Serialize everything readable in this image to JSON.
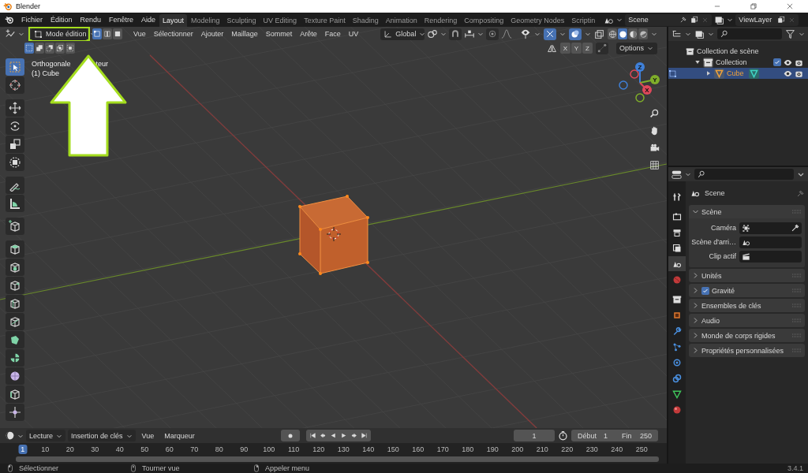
{
  "window": {
    "title": "Blender"
  },
  "menus": [
    "Fichier",
    "Édition",
    "Rendu",
    "Fenêtre",
    "Aide"
  ],
  "workspaces": [
    {
      "label": "Layout",
      "selected": true
    },
    {
      "label": "Modeling",
      "selected": false
    },
    {
      "label": "Sculpting",
      "selected": false
    },
    {
      "label": "UV Editing",
      "selected": false
    },
    {
      "label": "Texture Paint",
      "selected": false
    },
    {
      "label": "Shading",
      "selected": false
    },
    {
      "label": "Animation",
      "selected": false
    },
    {
      "label": "Rendering",
      "selected": false
    },
    {
      "label": "Compositing",
      "selected": false
    },
    {
      "label": "Geometry Nodes",
      "selected": false
    },
    {
      "label": "Scriptin",
      "selected": false
    }
  ],
  "scene": "Scene",
  "view_layer": "ViewLayer",
  "viewport": {
    "mode": "Mode édition",
    "select_modes": [
      {
        "selected": true
      },
      {
        "selected": false
      },
      {
        "selected": false
      }
    ],
    "menus": [
      "Vue",
      "Sélectionner",
      "Ajouter",
      "Maillage",
      "Sommet",
      "Arête",
      "Face",
      "UV"
    ],
    "orientation": "Global",
    "select_ops": [
      {
        "selected": true
      },
      {
        "selected": false
      },
      {
        "selected": false
      },
      {
        "selected": false
      },
      {
        "selected": false
      }
    ],
    "mirror_axes": [
      {
        "label": "X",
        "on": false
      },
      {
        "label": "Y",
        "on": false
      },
      {
        "label": "Z",
        "on": false
      }
    ],
    "options": "Options",
    "view_name": [
      "Orthogonale",
      "teur"
    ],
    "object_name": "(1) Cube",
    "gizmo_axes": [
      {
        "label": "Z",
        "color": "#3f80d8"
      },
      {
        "label": "Y",
        "color": "#7fae2a"
      },
      {
        "label": "X",
        "color": "#e0485a"
      }
    ],
    "tool_groups": [
      [
        {
          "selected": true
        },
        {
          "selected": false
        }
      ],
      [
        {
          "selected": false
        },
        {
          "selected": false
        },
        {
          "selected": false
        },
        {
          "selected": false
        }
      ],
      [
        {
          "selected": false
        },
        {
          "selected": false
        }
      ],
      [
        {
          "selected": false
        }
      ],
      [
        {
          "selected": false
        },
        {
          "selected": false
        },
        {
          "selected": false
        },
        {
          "selected": false
        },
        {
          "selected": false
        },
        {
          "selected": false
        },
        {
          "selected": false
        },
        {
          "selected": false
        },
        {
          "selected": false
        },
        {
          "selected": false
        }
      ]
    ]
  },
  "outliner": {
    "tree": [
      {
        "label": "Collection de scène",
        "kind": "scene_collection",
        "selected": false,
        "children": [
          {
            "label": "Collection",
            "kind": "collection",
            "selected": false,
            "expanded": true,
            "checked": true,
            "children": [
              {
                "label": "Cube",
                "kind": "object",
                "selected": true,
                "expanded": false
              }
            ]
          }
        ]
      }
    ]
  },
  "properties": {
    "tab_groups": [
      [
        {
          "selected": false
        }
      ],
      [
        {
          "selected": false
        },
        {
          "selected": false
        },
        {
          "selected": false
        },
        {
          "selected": true
        },
        {
          "selected": false
        }
      ],
      [
        {
          "selected": false
        },
        {
          "selected": false
        },
        {
          "selected": false
        },
        {
          "selected": false
        },
        {
          "selected": false
        },
        {
          "selected": false
        },
        {
          "selected": false
        },
        {
          "selected": false
        }
      ]
    ],
    "title": "Scene",
    "panels": [
      {
        "label": "Scène",
        "kind": "plain",
        "expanded": true,
        "fields": [
          {
            "label": "Caméra"
          },
          {
            "label": "Scène d'arri…"
          },
          {
            "label": "Clip actif"
          }
        ]
      },
      {
        "label": "Unités",
        "kind": "plain",
        "expanded": false
      },
      {
        "label": "Gravité",
        "kind": "toggle",
        "expanded": false,
        "checked": true
      },
      {
        "label": "Ensembles de clés",
        "kind": "plain",
        "expanded": false
      },
      {
        "label": "Audio",
        "kind": "plain",
        "expanded": false
      },
      {
        "label": "Monde de corps rigides",
        "kind": "plain",
        "expanded": false
      },
      {
        "label": "Propriétés personnalisées",
        "kind": "plain",
        "expanded": false
      }
    ]
  },
  "timeline": {
    "menus": [
      {
        "label": "Lecture",
        "kind": "dropdown"
      },
      {
        "label": "Insertion de clés",
        "kind": "dropdown"
      },
      {
        "label": "Vue",
        "kind": "menu"
      },
      {
        "label": "Marqueur",
        "kind": "menu"
      }
    ],
    "current_frame": "1",
    "start_label": "Début",
    "start": "1",
    "end_label": "Fin",
    "end": "250",
    "ruler": [
      {
        "label": "1",
        "selected": true
      },
      {
        "label": "10",
        "selected": false
      },
      {
        "label": "20",
        "selected": false
      },
      {
        "label": "30",
        "selected": false
      },
      {
        "label": "40",
        "selected": false
      },
      {
        "label": "50",
        "selected": false
      },
      {
        "label": "60",
        "selected": false
      },
      {
        "label": "70",
        "selected": false
      },
      {
        "label": "80",
        "selected": false
      },
      {
        "label": "90",
        "selected": false
      },
      {
        "label": "100",
        "selected": false
      },
      {
        "label": "110",
        "selected": false
      },
      {
        "label": "120",
        "selected": false
      },
      {
        "label": "130",
        "selected": false
      },
      {
        "label": "140",
        "selected": false
      },
      {
        "label": "150",
        "selected": false
      },
      {
        "label": "160",
        "selected": false
      },
      {
        "label": "170",
        "selected": false
      },
      {
        "label": "180",
        "selected": false
      },
      {
        "label": "190",
        "selected": false
      },
      {
        "label": "200",
        "selected": false
      },
      {
        "label": "210",
        "selected": false
      },
      {
        "label": "220",
        "selected": false
      },
      {
        "label": "230",
        "selected": false
      },
      {
        "label": "240",
        "selected": false
      },
      {
        "label": "250",
        "selected": false
      }
    ]
  },
  "status_bar": {
    "hints": [
      "Sélectionner",
      "Tourner vue",
      "Appeler menu"
    ],
    "version": "3.4.1"
  }
}
